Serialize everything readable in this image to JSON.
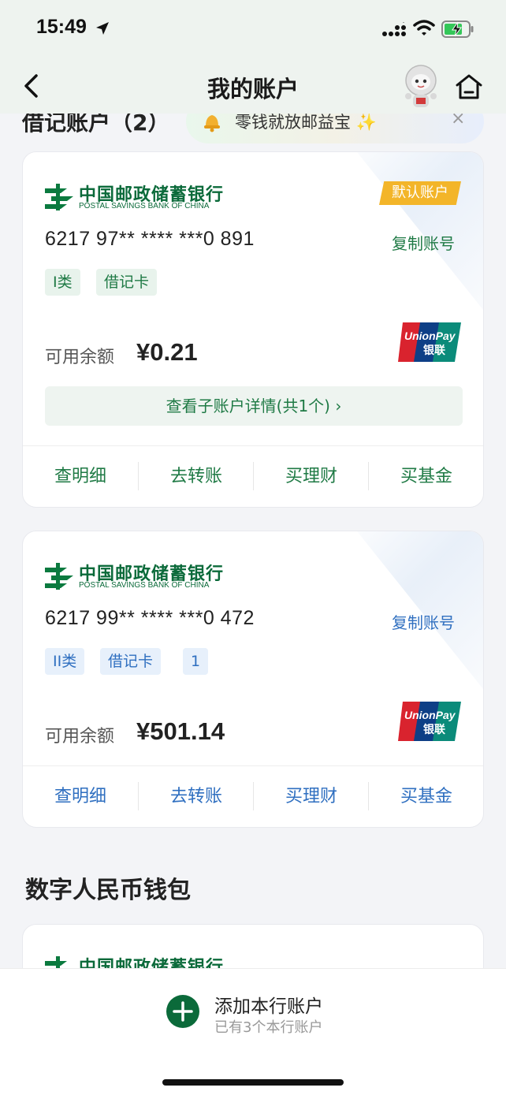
{
  "status_bar": {
    "time": "15:49"
  },
  "nav": {
    "title": "我的账户"
  },
  "section_partial": {
    "label": "借记账户（2）"
  },
  "promo": {
    "text": "零钱就放邮益宝 ✨",
    "close": "×"
  },
  "bank": {
    "name_cn": "中国邮政储蓄银行",
    "name_en": "POSTAL SAVINGS BANK OF CHINA"
  },
  "cards": [
    {
      "badge": "默认账户",
      "number": "6217 97** **** ***0 891",
      "copy": "复制账号",
      "tags": [
        "I类",
        "借记卡"
      ],
      "balance_label": "可用余额",
      "balance": "¥0.21",
      "sub_account": "查看子账户详情(共1个)  ›",
      "actions": [
        "查明细",
        "去转账",
        "买理财",
        "买基金"
      ]
    },
    {
      "number": "6217 99** **** ***0 472",
      "copy": "复制账号",
      "tags": [
        "II类",
        "借记卡",
        "1"
      ],
      "balance_label": "可用余额",
      "balance": "¥501.14",
      "actions": [
        "查明细",
        "去转账",
        "买理财",
        "买基金"
      ]
    }
  ],
  "digital_wallet": {
    "title": "数字人民币钱包"
  },
  "bottom": {
    "add_title": "添加本行账户",
    "add_sub": "已有3个本行账户"
  },
  "colors": {
    "green": "#1f7a45",
    "blue": "#2f6fc0",
    "badge": "#f3b529",
    "add_button": "#0b6a3a"
  }
}
